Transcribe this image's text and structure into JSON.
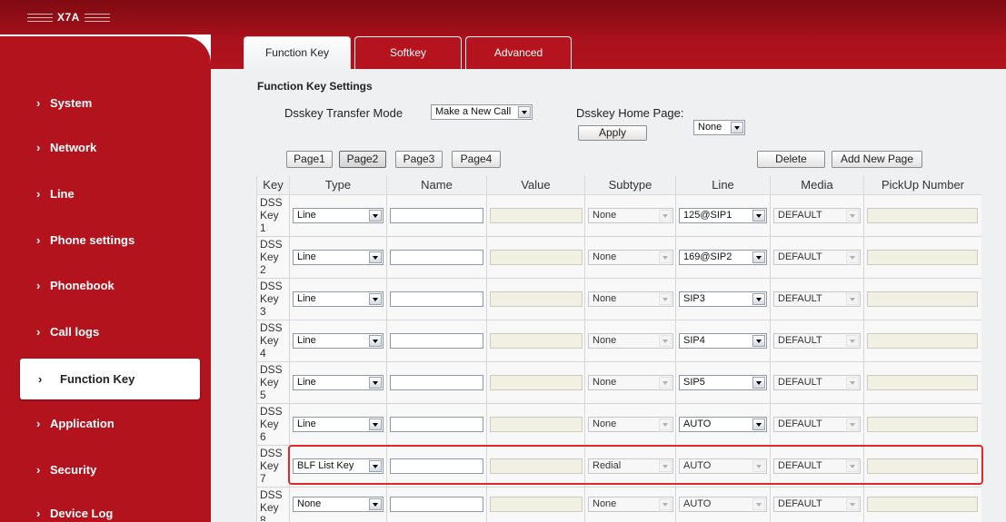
{
  "header": {
    "logo_text": "X7A"
  },
  "colors": {
    "brand_red": "#b3131d",
    "header_red": "#930e17",
    "tab_red": "#a8111b",
    "highlight_red": "#e0282e"
  },
  "sidebar": {
    "items": [
      {
        "label": "System"
      },
      {
        "label": "Network"
      },
      {
        "label": "Line"
      },
      {
        "label": "Phone settings"
      },
      {
        "label": "Phonebook"
      },
      {
        "label": "Call logs"
      },
      {
        "label": "Function Key",
        "selected": true
      },
      {
        "label": "Application"
      },
      {
        "label": "Security"
      },
      {
        "label": "Device Log"
      }
    ]
  },
  "tabs": [
    {
      "label": "Function Key",
      "active": true
    },
    {
      "label": "Softkey"
    },
    {
      "label": "Advanced"
    }
  ],
  "settings": {
    "title": "Function Key Settings",
    "transfer_mode_label": "Dsskey Transfer Mode",
    "transfer_mode_value": "Make a New Call",
    "home_page_label": "Dsskey Home Page:",
    "home_page_value": "None",
    "apply_label": "Apply"
  },
  "pages": {
    "buttons": [
      "Page1",
      "Page2",
      "Page3",
      "Page4"
    ],
    "delete_label": "Delete",
    "add_label": "Add New Page"
  },
  "table": {
    "headers": [
      "Key",
      "Type",
      "Name",
      "Value",
      "Subtype",
      "Line",
      "Media",
      "PickUp Number"
    ],
    "rows": [
      {
        "key": "DSS Key 1",
        "type": "Line",
        "name": "",
        "value": "",
        "subtype": "None",
        "line": "125@SIP1",
        "line_enabled": true,
        "media": "DEFAULT",
        "pickup": ""
      },
      {
        "key": "DSS Key 2",
        "type": "Line",
        "name": "",
        "value": "",
        "subtype": "None",
        "line": "169@SIP2",
        "line_enabled": true,
        "media": "DEFAULT",
        "pickup": ""
      },
      {
        "key": "DSS Key 3",
        "type": "Line",
        "name": "",
        "value": "",
        "subtype": "None",
        "line": "SIP3",
        "line_enabled": true,
        "media": "DEFAULT",
        "pickup": ""
      },
      {
        "key": "DSS Key 4",
        "type": "Line",
        "name": "",
        "value": "",
        "subtype": "None",
        "line": "SIP4",
        "line_enabled": true,
        "media": "DEFAULT",
        "pickup": ""
      },
      {
        "key": "DSS Key 5",
        "type": "Line",
        "name": "",
        "value": "",
        "subtype": "None",
        "line": "SIP5",
        "line_enabled": true,
        "media": "DEFAULT",
        "pickup": ""
      },
      {
        "key": "DSS Key 6",
        "type": "Line",
        "name": "",
        "value": "",
        "subtype": "None",
        "line": "AUTO",
        "line_enabled": true,
        "media": "DEFAULT",
        "pickup": ""
      },
      {
        "key": "DSS Key 7",
        "type": "BLF List Key",
        "name": "",
        "value": "",
        "subtype": "Redial",
        "line": "AUTO",
        "line_enabled": false,
        "media": "DEFAULT",
        "pickup": "",
        "highlighted": true
      },
      {
        "key": "DSS Key 8",
        "type": "None",
        "name": "",
        "value": "",
        "subtype": "None",
        "line": "AUTO",
        "line_enabled": false,
        "media": "DEFAULT",
        "pickup": ""
      }
    ]
  }
}
